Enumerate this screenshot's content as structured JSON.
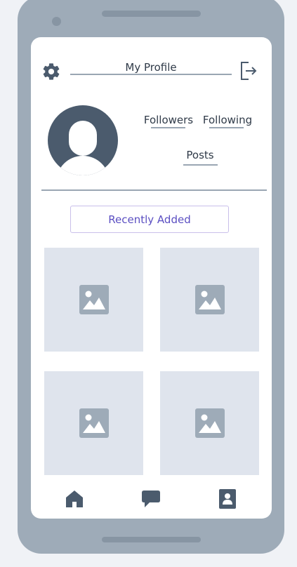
{
  "header": {
    "title": "My Profile",
    "settings_icon": "gear-icon",
    "logout_icon": "logout-icon"
  },
  "profile": {
    "avatar_icon": "user-avatar-icon",
    "stats": {
      "followers_label": "Followers",
      "following_label": "Following",
      "posts_label": "Posts"
    }
  },
  "recent": {
    "button_label": "Recently Added"
  },
  "gallery": {
    "items": [
      {
        "icon": "image-placeholder-icon"
      },
      {
        "icon": "image-placeholder-icon"
      },
      {
        "icon": "image-placeholder-icon"
      },
      {
        "icon": "image-placeholder-icon"
      }
    ]
  },
  "bottom_nav": {
    "items": [
      {
        "icon": "home-icon"
      },
      {
        "icon": "chat-icon"
      },
      {
        "icon": "profile-icon"
      }
    ]
  },
  "colors": {
    "accent": "#5b4fc2",
    "dark": "#4b5b6d",
    "frame": "#9eabb8",
    "placeholder": "#dfe4ed"
  }
}
